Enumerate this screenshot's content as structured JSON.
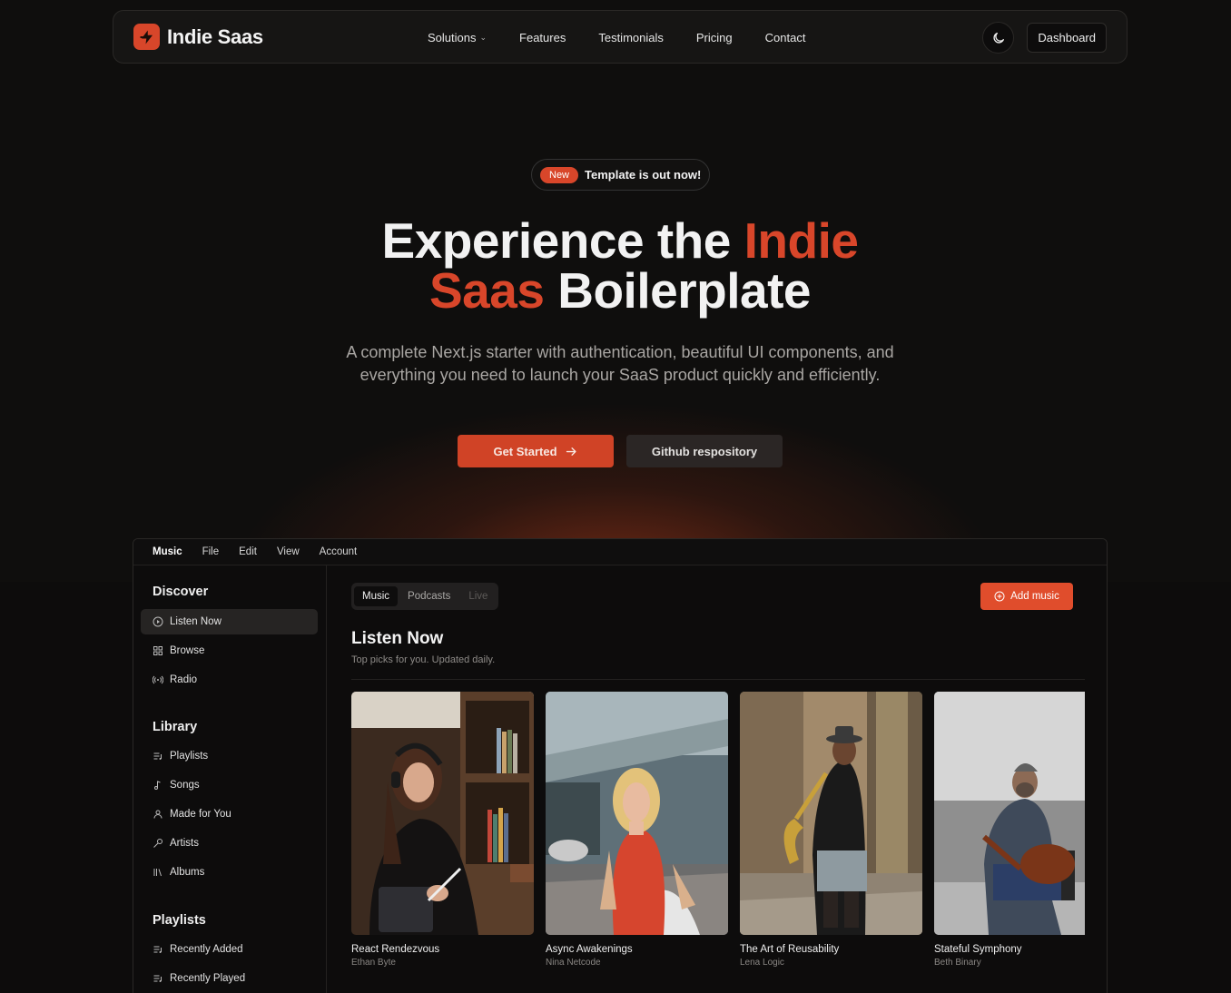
{
  "brand": {
    "name": "Indie Saas"
  },
  "nav": {
    "links": [
      "Solutions",
      "Features",
      "Testimonials",
      "Pricing",
      "Contact"
    ],
    "dashboard_label": "Dashboard"
  },
  "hero": {
    "badge_new": "New",
    "badge_text": "Template is out now!",
    "title_part1": "Experience the",
    "title_accent1": "Indie",
    "title_accent2": "Saas",
    "title_part2": "Boilerplate",
    "subtitle": "A complete Next.js starter with authentication, beautiful UI components, and everything you need to launch your SaaS product quickly and efficiently.",
    "cta_primary": "Get Started",
    "cta_secondary": "Github respository"
  },
  "colors": {
    "accent": "#d8462a",
    "background": "#0f0e0d"
  },
  "app": {
    "menubar": [
      "Music",
      "File",
      "Edit",
      "View",
      "Account"
    ],
    "sidebar": {
      "discover_heading": "Discover",
      "discover": [
        {
          "label": "Listen Now",
          "icon": "play-circle-icon"
        },
        {
          "label": "Browse",
          "icon": "grid-icon"
        },
        {
          "label": "Radio",
          "icon": "radio-icon"
        }
      ],
      "library_heading": "Library",
      "library": [
        {
          "label": "Playlists",
          "icon": "playlist-icon"
        },
        {
          "label": "Songs",
          "icon": "music-note-icon"
        },
        {
          "label": "Made for You",
          "icon": "user-icon"
        },
        {
          "label": "Artists",
          "icon": "microphone-icon"
        },
        {
          "label": "Albums",
          "icon": "library-icon"
        }
      ],
      "playlists_heading": "Playlists",
      "playlists": [
        {
          "label": "Recently Added",
          "icon": "playlist-icon"
        },
        {
          "label": "Recently Played",
          "icon": "playlist-icon"
        }
      ]
    },
    "tabs": [
      "Music",
      "Podcasts",
      "Live"
    ],
    "add_music": "Add music",
    "title": "Listen Now",
    "subtitle": "Top picks for you. Updated daily.",
    "albums": [
      {
        "title": "React Rendezvous",
        "artist": "Ethan Byte"
      },
      {
        "title": "Async Awakenings",
        "artist": "Nina Netcode"
      },
      {
        "title": "The Art of Reusability",
        "artist": "Lena Logic"
      },
      {
        "title": "Stateful Symphony",
        "artist": "Beth Binary"
      }
    ]
  }
}
